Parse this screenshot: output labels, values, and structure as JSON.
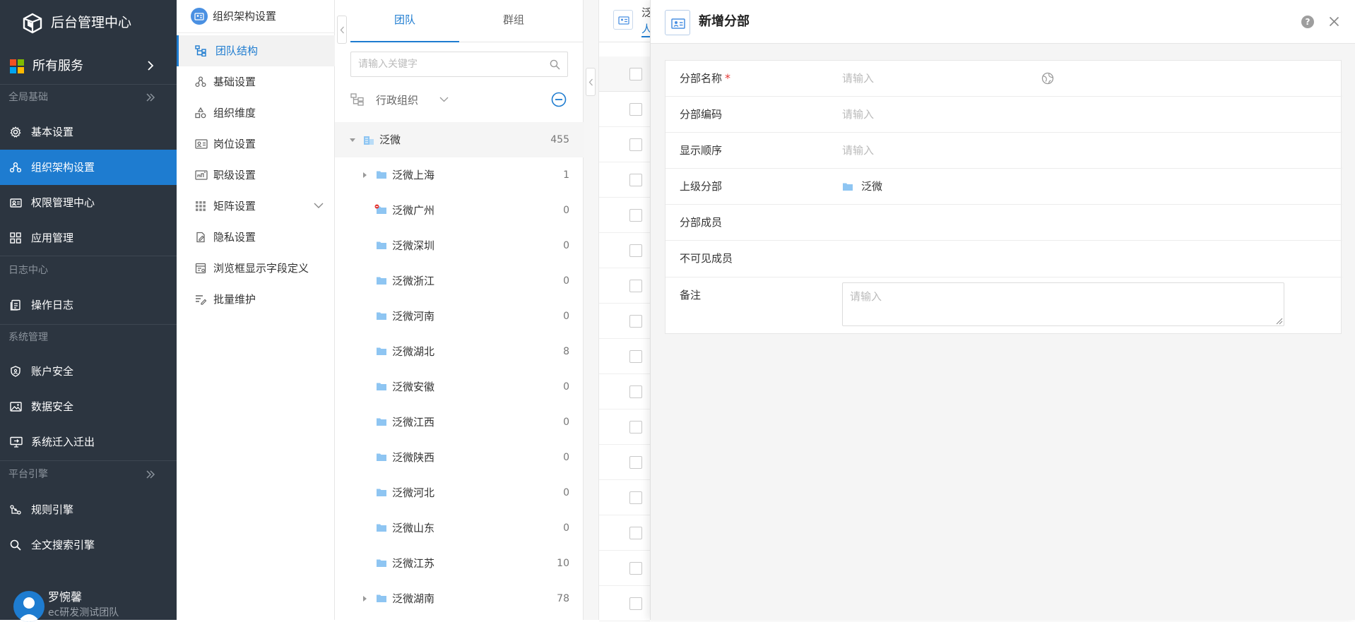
{
  "sidebar": {
    "app_title": "后台管理中心",
    "all_services": "所有服务",
    "sections": [
      {
        "title": "全局基础",
        "items": [
          "基本设置",
          "组织架构设置",
          "权限管理中心",
          "应用管理"
        ]
      },
      {
        "title": "日志中心",
        "items": [
          "操作日志"
        ]
      },
      {
        "title": "系统管理",
        "items": [
          "账户安全",
          "数据安全",
          "系统迁入迁出"
        ]
      },
      {
        "title": "平台引擎",
        "items": [
          "规则引擎",
          "全文搜索引擎"
        ]
      }
    ],
    "active_item": "组织架构设置",
    "user": {
      "name": "罗惋馨",
      "dept": "ec研发测试团队"
    }
  },
  "submenu": {
    "title": "组织架构设置",
    "items": [
      "团队结构",
      "基础设置",
      "组织维度",
      "岗位设置",
      "职级设置",
      "矩阵设置",
      "隐私设置",
      "浏览框显示字段定义",
      "批量维护"
    ],
    "active": "团队结构"
  },
  "tree": {
    "tabs": [
      "团队",
      "群组"
    ],
    "active_tab": "团队",
    "search_placeholder": "请输入关键字",
    "org_type": "行政组织",
    "root": {
      "name": "泛微",
      "count": "455"
    },
    "children": [
      {
        "name": "泛微上海",
        "count": "1"
      },
      {
        "name": "泛微广州",
        "count": "0"
      },
      {
        "name": "泛微深圳",
        "count": "0"
      },
      {
        "name": "泛微浙江",
        "count": "0"
      },
      {
        "name": "泛微河南",
        "count": "0"
      },
      {
        "name": "泛微湖北",
        "count": "8"
      },
      {
        "name": "泛微安徽",
        "count": "0"
      },
      {
        "name": "泛微江西",
        "count": "0"
      },
      {
        "name": "泛微陕西",
        "count": "0"
      },
      {
        "name": "泛微河北",
        "count": "0"
      },
      {
        "name": "泛微山东",
        "count": "0"
      },
      {
        "name": "泛微江苏",
        "count": "10"
      },
      {
        "name": "泛微湖南",
        "count": "78"
      }
    ]
  },
  "background_panel": {
    "title": "泛微",
    "tab": "人力资"
  },
  "drawer": {
    "title": "新增分部",
    "help_label": "?",
    "fields": {
      "name_label": "分部名称",
      "name_required_mark": "*",
      "name_placeholder": "请输入",
      "code_label": "分部编码",
      "code_placeholder": "请输入",
      "order_label": "显示顺序",
      "order_placeholder": "请输入",
      "parent_label": "上级分部",
      "parent_value": "泛微",
      "members_label": "分部成员",
      "invisible_label": "不可见成员",
      "remark_label": "备注",
      "remark_placeholder": "请输入"
    }
  },
  "colors": {
    "sidebar_bg": "#2c3540",
    "accent": "#1e7cd0",
    "folder": "#8ec5f2",
    "required": "#e53935"
  }
}
